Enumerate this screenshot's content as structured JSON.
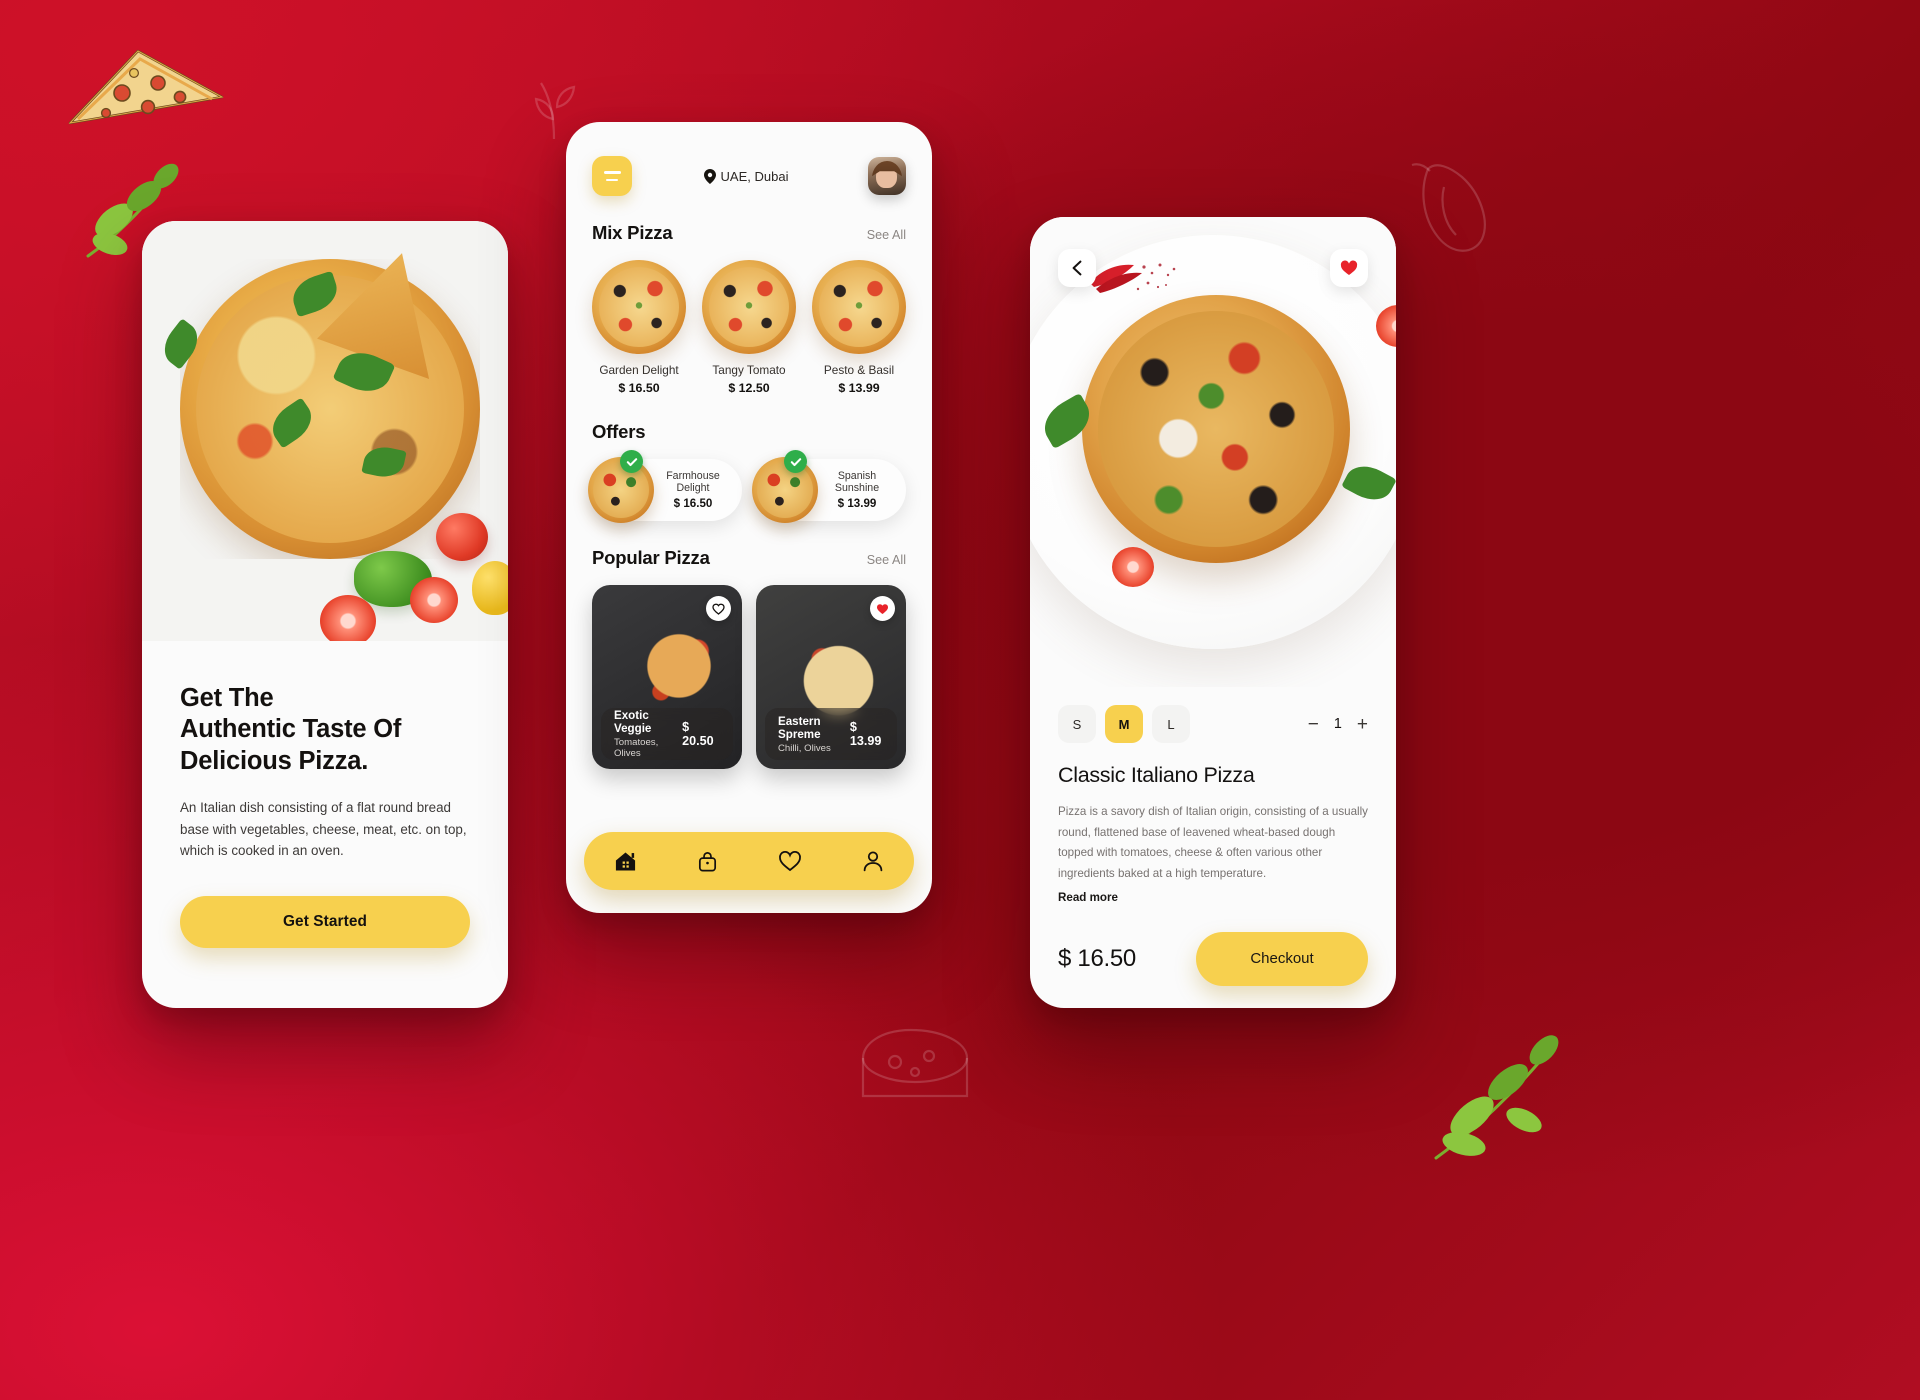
{
  "theme": {
    "accent_yellow": "#F7D04E",
    "bg_red_light": "#D91034",
    "bg_red_dark": "#8E0812",
    "success_green": "#2FAE4A",
    "heart_red": "#E8232A"
  },
  "onboarding": {
    "title_lines": [
      "Get The",
      "Authentic Taste Of",
      "Delicious Pizza."
    ],
    "subtitle": "An Italian dish consisting of a flat round bread base with vegetables, cheese, meat, etc. on top, which is cooked in an oven.",
    "cta_label": "Get Started"
  },
  "home": {
    "menu_icon": "hamburger-menu-icon",
    "location": "UAE, Dubai",
    "location_icon": "map-pin-icon",
    "avatar_name": "user-avatar",
    "sections": {
      "mix": {
        "title": "Mix Pizza",
        "see_all": "See All"
      },
      "offers": {
        "title": "Offers"
      },
      "popular": {
        "title": "Popular Pizza",
        "see_all": "See All"
      }
    },
    "mix_pizzas": [
      {
        "name": "Garden Delight",
        "price": "$ 16.50"
      },
      {
        "name": "Tangy Tomato",
        "price": "$ 12.50"
      },
      {
        "name": "Pesto & Basil",
        "price": "$ 13.99"
      }
    ],
    "offers": [
      {
        "name": "Farmhouse Delight",
        "price": "$ 16.50",
        "selected": true
      },
      {
        "name": "Spanish Sunshine",
        "price": "$ 13.99",
        "selected": true
      }
    ],
    "popular_pizzas": [
      {
        "name": "Exotic Veggie",
        "desc": "Tomatoes, Olives",
        "price": "$ 20.50",
        "favorited": false
      },
      {
        "name": "Eastern Spreme",
        "desc": "Chilli, Olives",
        "price": "$ 13.99",
        "favorited": true
      }
    ],
    "tabs": [
      {
        "icon": "home-icon",
        "active": true
      },
      {
        "icon": "bag-icon",
        "active": false
      },
      {
        "icon": "heart-icon",
        "active": false
      },
      {
        "icon": "person-icon",
        "active": false
      }
    ]
  },
  "detail": {
    "back_icon": "chevron-left-icon",
    "favorite_icon": "heart-filled-icon",
    "sizes": [
      "S",
      "M",
      "L"
    ],
    "selected_size": "M",
    "quantity": "1",
    "decrement_label": "−",
    "increment_label": "+",
    "title": "Classic Italiano Pizza",
    "description": "Pizza is a savory dish of Italian origin, consisting of a usually round, flattened base of leavened wheat-based dough topped with tomatoes, cheese & often various other ingredients baked at a high temperature.",
    "read_more_label": "Read more",
    "price": "$ 16.50",
    "checkout_label": "Checkout"
  }
}
